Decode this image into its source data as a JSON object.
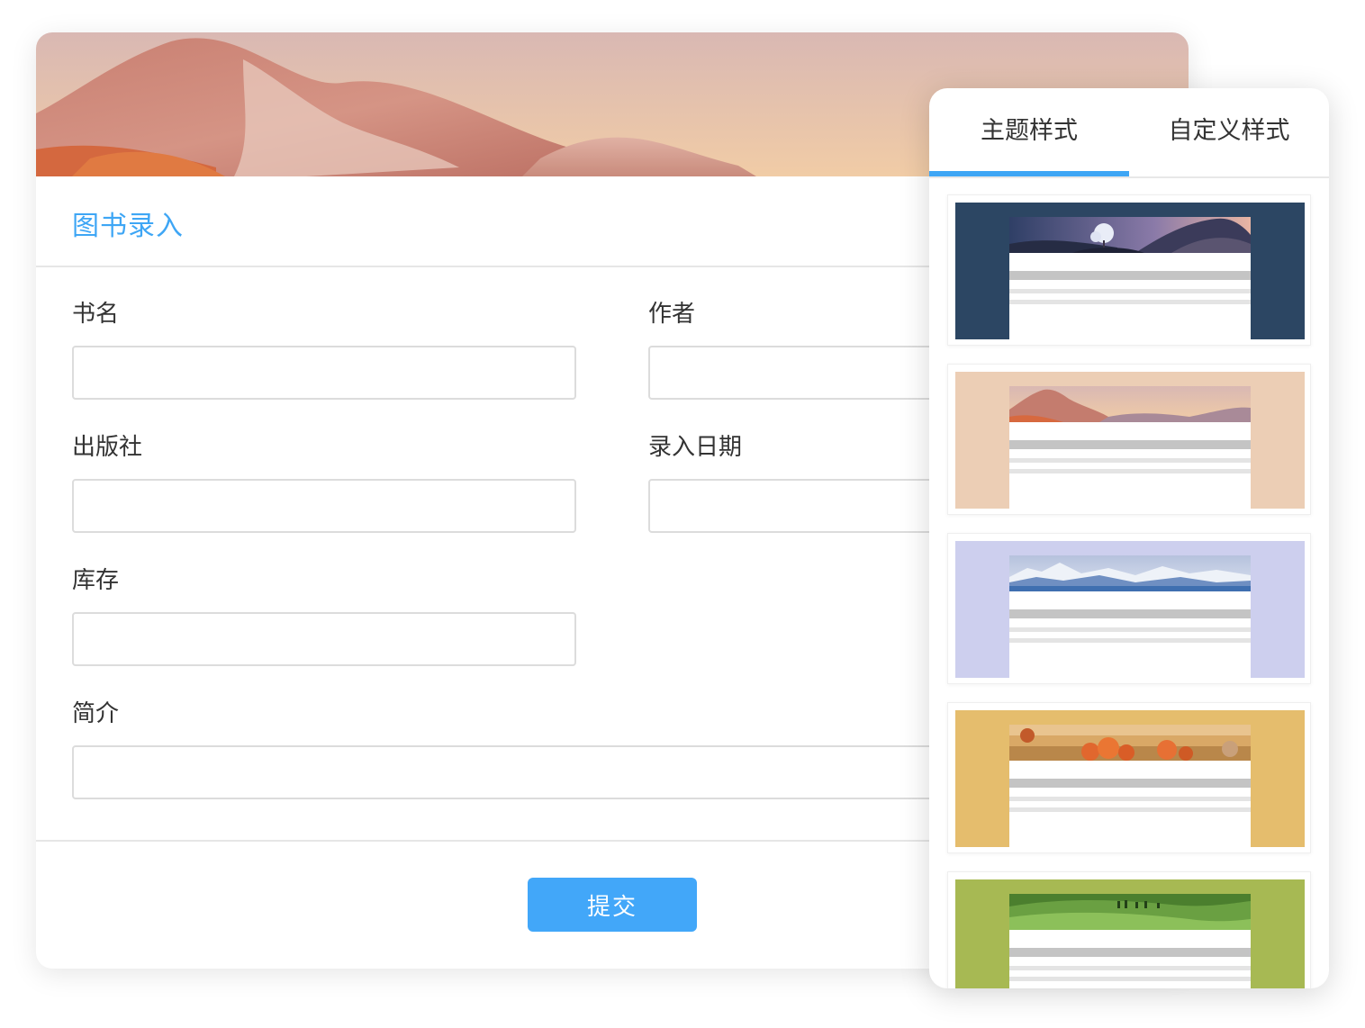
{
  "form": {
    "title": "图书录入",
    "fields": {
      "book_name": {
        "label": "书名",
        "value": ""
      },
      "author": {
        "label": "作者",
        "value": ""
      },
      "publisher": {
        "label": "出版社",
        "value": ""
      },
      "entry_date": {
        "label": "录入日期",
        "value": ""
      },
      "stock": {
        "label": "库存",
        "value": ""
      },
      "intro": {
        "label": "简介",
        "value": ""
      }
    },
    "submit_label": "提交"
  },
  "panel": {
    "tabs": [
      {
        "label": "主题样式",
        "active": true
      },
      {
        "label": "自定义样式",
        "active": false
      }
    ],
    "themes": [
      {
        "name": "night-dunes",
        "background": "#2c4663",
        "scene": "dunes-tree"
      },
      {
        "name": "pink-mountain",
        "background": "#ecceb5",
        "scene": "pink-mountain"
      },
      {
        "name": "snow-mountain",
        "background": "#cdcfee",
        "scene": "snow-mountain"
      },
      {
        "name": "autumn-grassland",
        "background": "#e5bd6d",
        "scene": "autumn-trees"
      },
      {
        "name": "green-prairie",
        "background": "#a7b953",
        "scene": "green-hills"
      }
    ]
  },
  "colors": {
    "accent": "#3ea6f5",
    "button": "#42a7f9",
    "input_border": "#dcdcdc"
  }
}
